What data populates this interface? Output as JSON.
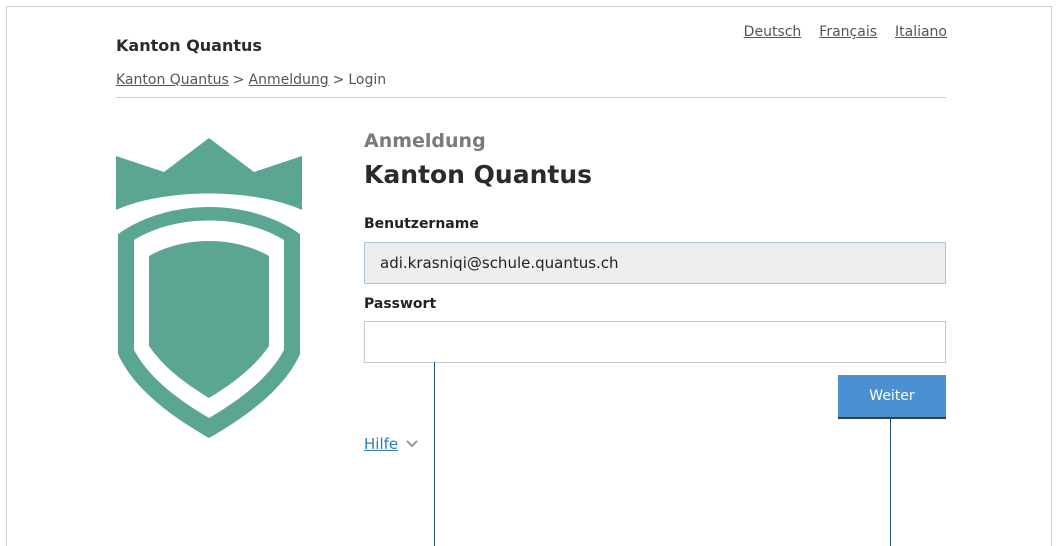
{
  "header": {
    "site_title": "Kanton Quantus",
    "languages": [
      "Deutsch",
      "Français",
      "Italiano"
    ]
  },
  "breadcrumb": {
    "items": [
      "Kanton Quantus",
      "Anmeldung",
      "Login"
    ],
    "separator": ">"
  },
  "form": {
    "subtitle": "Anmeldung",
    "title": "Kanton Quantus",
    "username_label": "Benutzername",
    "username_value": "adi.krasniqi@schule.quantus.ch",
    "password_label": "Passwort",
    "password_value": "",
    "submit_label": "Weiter",
    "help_label": "Hilfe"
  },
  "colors": {
    "brand_green": "#5aa693",
    "button_blue": "#4a90d2",
    "link_blue": "#2e7bb8"
  },
  "icons": {
    "logo": "shield-crown-logo",
    "help_toggle": "chevron-down-icon"
  }
}
